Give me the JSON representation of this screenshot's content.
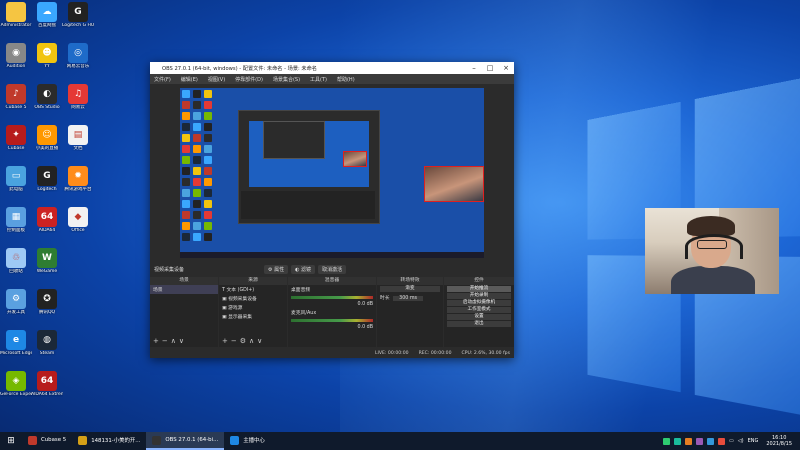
{
  "obs": {
    "title": "OBS 27.0.1 (64-bit, windows) - 配置文件: 未命名 - 场景: 未命名",
    "menu": [
      "文件(F)",
      "编辑(E)",
      "视图(V)",
      "停靠部件(D)",
      "场景集合(S)",
      "工具(T)",
      "帮助(H)"
    ],
    "current_scene": "视频采集设备",
    "props_label": "属性",
    "filters_label": "滤镜",
    "deactivate_label": "取消激活",
    "scenes_header": "场景",
    "scenes": [
      "场景"
    ],
    "sources_header": "来源",
    "sources": [
      "文本 (GDI+)",
      "视频采集设备",
      "游戏源",
      "显示器采集"
    ],
    "mixer_header": "混音器",
    "mixer": [
      {
        "name": "桌面音频",
        "level": "0.0 dB"
      },
      {
        "name": "麦克风/Aux",
        "level": "0.0 dB"
      }
    ],
    "transitions_header": "转场特效",
    "transition_type": "渐变",
    "duration_label": "时长",
    "duration_value": "300 ms",
    "controls_header": "控件",
    "controls": [
      "开始推流",
      "开始录制",
      "启动虚拟摄像机",
      "工作室模式",
      "设置",
      "退出"
    ],
    "status": {
      "live": "LIVE: 00:00:00",
      "rec": "REC: 00:00:00",
      "cpu": "CPU: 2.6%, 30.00 fps"
    }
  },
  "taskbar": {
    "items": [
      {
        "label": "Cubase 5",
        "color": "#c0392b",
        "active": false
      },
      {
        "label": "148131-小美的开...",
        "color": "#d4a017",
        "active": false
      },
      {
        "label": "OBS 27.0.1 (64-bi...",
        "color": "#333333",
        "active": true
      },
      {
        "label": "主播中心",
        "color": "#1e88e5",
        "active": false
      }
    ],
    "tray_lang": "ENG",
    "time": "16:10",
    "date": "2021/8/15"
  },
  "desktop": {
    "icons": [
      {
        "label": "Administrator",
        "color": "#f5c542",
        "glyph": "",
        "col": 0,
        "row": 0
      },
      {
        "label": "百度网盘",
        "color": "#3aa7ff",
        "glyph": "☁",
        "col": 1,
        "row": 0
      },
      {
        "label": "Logitech G HUB",
        "color": "#222222",
        "glyph": "G",
        "col": 2,
        "row": 0
      },
      {
        "label": "Audition",
        "color": "#888888",
        "glyph": "◉",
        "col": 0,
        "row": 1
      },
      {
        "label": "YY",
        "color": "#f1c40f",
        "glyph": "☻",
        "col": 1,
        "row": 1
      },
      {
        "label": "网易云音乐",
        "color": "#1e6bc9",
        "glyph": "◎",
        "col": 2,
        "row": 1
      },
      {
        "label": "Cubase 5",
        "color": "#c0392b",
        "glyph": "♪",
        "col": 0,
        "row": 2
      },
      {
        "label": "OBS Studio",
        "color": "#2b2b2b",
        "glyph": "◐",
        "col": 1,
        "row": 2
      },
      {
        "label": "网易云",
        "color": "#e53935",
        "glyph": "♫",
        "col": 2,
        "row": 2
      },
      {
        "label": "Cubase",
        "color": "#b71c1c",
        "glyph": "✦",
        "col": 0,
        "row": 3
      },
      {
        "label": "小美的直播",
        "color": "#ff9800",
        "glyph": "☺",
        "col": 1,
        "row": 3
      },
      {
        "label": "文档",
        "color": "#f2f2f2",
        "glyph": "▤",
        "col": 2,
        "row": 3
      },
      {
        "label": "此电脑",
        "color": "#4aa3df",
        "glyph": "▭",
        "col": 0,
        "row": 4
      },
      {
        "label": "Logitech",
        "color": "#222222",
        "glyph": "G",
        "col": 1,
        "row": 4
      },
      {
        "label": "腾讯游戏平台",
        "color": "#ff8c1a",
        "glyph": "✹",
        "col": 2,
        "row": 4
      },
      {
        "label": "控制面板",
        "color": "#5aa0e0",
        "glyph": "▦",
        "col": 0,
        "row": 5
      },
      {
        "label": "AIDA64",
        "color": "#cc2222",
        "glyph": "64",
        "col": 1,
        "row": 5
      },
      {
        "label": "Office",
        "color": "#f2f2f2",
        "glyph": "◆",
        "col": 2,
        "row": 5
      },
      {
        "label": "回收站",
        "color": "#9ec9f5",
        "glyph": "♲",
        "col": 0,
        "row": 6
      },
      {
        "label": "WeGame",
        "color": "#2e7d32",
        "glyph": "W",
        "col": 1,
        "row": 6
      },
      {
        "label": "腾讯QQ",
        "color": "#222222",
        "glyph": "✪",
        "col": 1,
        "row": 7
      },
      {
        "label": "开发工具",
        "color": "#5aa0e0",
        "glyph": "⚙",
        "col": 0,
        "row": 7
      },
      {
        "label": "Microsoft Edge",
        "color": "#1e88e5",
        "glyph": "e",
        "col": 0,
        "row": 8
      },
      {
        "label": "Steam",
        "color": "#1b2838",
        "glyph": "◍",
        "col": 1,
        "row": 8
      },
      {
        "label": "GeForce Experience",
        "color": "#76b900",
        "glyph": "◈",
        "col": 0,
        "row": 9
      },
      {
        "label": "AIDA64 Extreme",
        "color": "#b71c1c",
        "glyph": "64",
        "col": 1,
        "row": 9
      }
    ]
  }
}
